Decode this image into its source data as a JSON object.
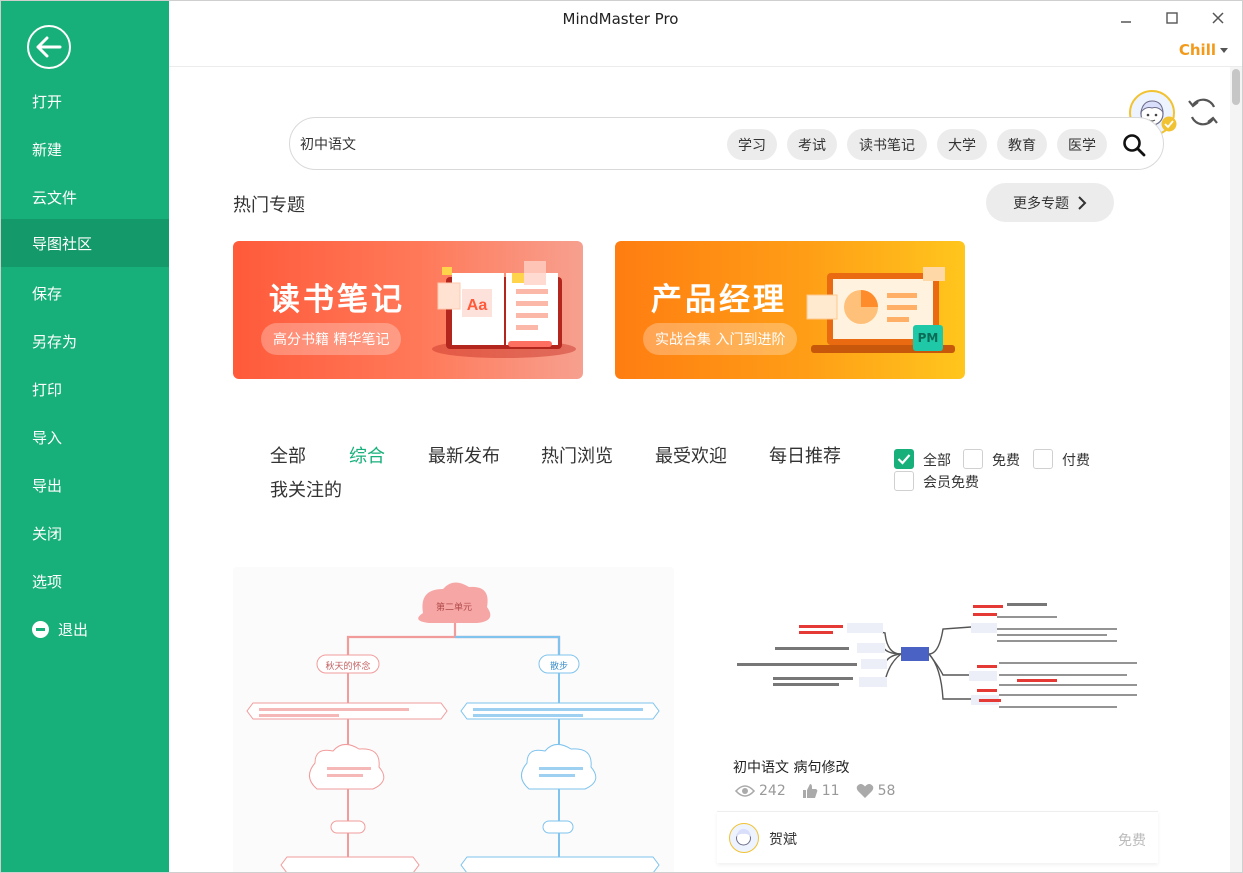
{
  "app": {
    "title": "MindMaster Pro",
    "user": "Chill"
  },
  "sidebar": {
    "items": [
      {
        "label": "打开"
      },
      {
        "label": "新建"
      },
      {
        "label": "云文件"
      },
      {
        "label": "导图社区"
      },
      {
        "label": "保存"
      },
      {
        "label": "另存为"
      },
      {
        "label": "打印"
      },
      {
        "label": "导入"
      },
      {
        "label": "导出"
      },
      {
        "label": "关闭"
      },
      {
        "label": "选项"
      },
      {
        "label": "退出"
      }
    ],
    "active": "导图社区"
  },
  "search": {
    "value": "初中语文",
    "tags": [
      "学习",
      "考试",
      "读书笔记",
      "大学",
      "教育",
      "医学"
    ]
  },
  "hot": {
    "title": "热门专题",
    "more_label": "更多专题",
    "banners": [
      {
        "title": "读书笔记",
        "subtitle": "高分书籍 精华笔记"
      },
      {
        "title": "产品经理",
        "subtitle": "实战合集 入门到进阶",
        "badge": "PM"
      }
    ]
  },
  "tabs": {
    "items": [
      "全部",
      "综合",
      "最新发布",
      "热门浏览",
      "最受欢迎",
      "每日推荐",
      "我关注的"
    ],
    "active": "综合"
  },
  "price_filter": {
    "options": [
      {
        "label": "全部",
        "checked": true
      },
      {
        "label": "免费",
        "checked": false
      },
      {
        "label": "付费",
        "checked": false
      },
      {
        "label": "会员免费",
        "checked": false
      }
    ]
  },
  "cards": [
    {
      "preview_nodes": [
        "第二单元",
        "秋天的怀念",
        "散步"
      ]
    },
    {
      "title": "初中语文 病句修改",
      "views": "242",
      "likes": "11",
      "favorites": "58",
      "author": "贺斌",
      "price": "免费"
    }
  ],
  "colors": {
    "brand": "#18b07a",
    "accent_user": "#f39a1a"
  }
}
